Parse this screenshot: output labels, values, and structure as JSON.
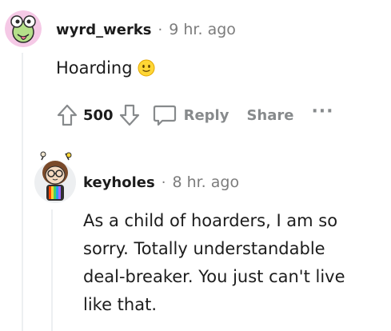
{
  "parent_comment": {
    "username": "wyrd_werks",
    "separator": "·",
    "time": "9 hr. ago",
    "body": "Hoarding",
    "emoji": "slightly-smiling-face",
    "score": "500",
    "reply_label": "Reply",
    "share_label": "Share",
    "more_label": "···"
  },
  "child_comment": {
    "username": "keyholes",
    "separator": "·",
    "time": "8 hr. ago",
    "body_lines": [
      "As a child of hoarders, I am so",
      "sorry. Totally understandable",
      "deal-breaker. You just can't live",
      "like that."
    ]
  },
  "colors": {
    "text": "#1c1c1c",
    "meta": "#7c7c7c",
    "action": "#878a8c",
    "thread_line": "#edeff1",
    "emoji": "#ffd635"
  }
}
